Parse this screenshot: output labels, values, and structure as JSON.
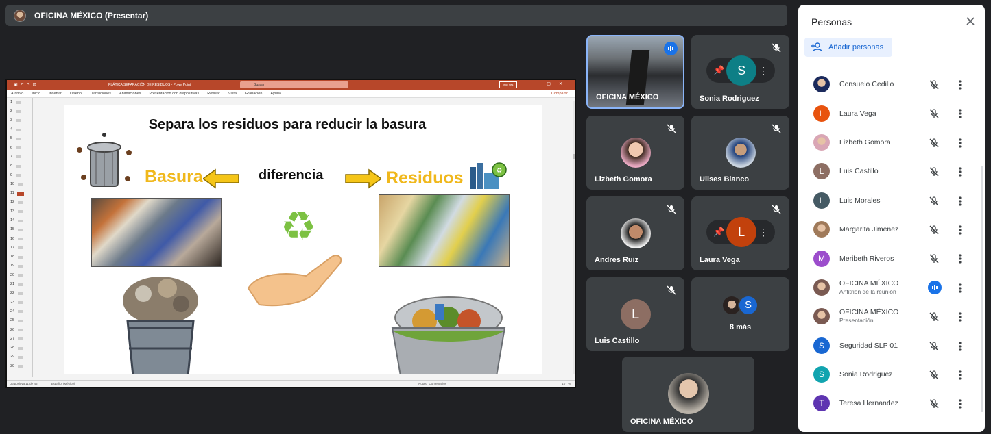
{
  "topbar": {
    "title": "OFICINA MÉXICO (Presentar)"
  },
  "ppt": {
    "window_title": "PLÁTICA SEPARACIÓN DE RESIDUOS - PowerPoint",
    "search_placeholder": "Buscar",
    "user_badge": "Inic. ses",
    "menu": [
      "Archivo",
      "Inicio",
      "Insertar",
      "Diseño",
      "Transiciones",
      "Animaciones",
      "Presentación con diapositivas",
      "Revisar",
      "Vista",
      "Grabación",
      "Ayuda"
    ],
    "share": "Compartir",
    "thumbnails": [
      "1",
      "2",
      "3",
      "4",
      "5",
      "6",
      "7",
      "8",
      "9",
      "10",
      "11",
      "12",
      "13",
      "14",
      "15",
      "16",
      "17",
      "18",
      "19",
      "20",
      "21",
      "22",
      "23",
      "24",
      "25",
      "26",
      "27",
      "28",
      "29",
      "30"
    ],
    "selected_slide": 11,
    "status_left": "Diapositiva 11 de 46",
    "status_lang": "Español (México)",
    "status_notes": "Notas",
    "status_comments": "Comentarios",
    "zoom": "107 %",
    "slide": {
      "heading": "Separa los residuos para reducir la basura",
      "left_word": "Basura",
      "middle_word": "diferencia",
      "right_word": "Residuos"
    }
  },
  "tiles": [
    {
      "name": "OFICINA MÉXICO",
      "speaking": true
    },
    {
      "name": "Sonia Rodriguez",
      "muted": true
    },
    {
      "name": "Lizbeth Gomora",
      "muted": true
    },
    {
      "name": "Ulises Blanco",
      "muted": true
    },
    {
      "name": "Andres Ruiz",
      "muted": true
    },
    {
      "name": "Laura Vega",
      "muted": true
    },
    {
      "name": "Luis Castillo",
      "muted": true,
      "initial": "L"
    },
    {
      "more_label": "8 más",
      "initial": "S"
    },
    {
      "name": "OFICINA MÉXICO"
    }
  ],
  "panel": {
    "title": "Personas",
    "add_label": "Añadir personas",
    "people": [
      {
        "name": "Consuelo Cedillo",
        "avatar": "photo",
        "color": "#1b2a5c"
      },
      {
        "name": "Laura Vega",
        "initial": "L",
        "color": "#e8530e"
      },
      {
        "name": "Lizbeth Gomora",
        "avatar": "photo",
        "color": "#d9a6b5"
      },
      {
        "name": "Luis Castillo",
        "initial": "L",
        "color": "#8d6e63"
      },
      {
        "name": "Luis Morales",
        "initial": "L",
        "color": "#455a64"
      },
      {
        "name": "Margarita Jimenez",
        "avatar": "photo",
        "color": "#a07a5a"
      },
      {
        "name": "Meribeth Riveros",
        "initial": "M",
        "color": "#9c4dcc"
      },
      {
        "name": "OFICINA MÉXICO",
        "sub": "Anfitrión de la reunión",
        "avatar": "photo",
        "color": "#7a5a52",
        "speaking": true
      },
      {
        "name": "OFICINA MÉXICO",
        "sub": "Presentación",
        "avatar": "photo",
        "color": "#7a5a52"
      },
      {
        "name": "Seguridad SLP 01",
        "initial": "S",
        "color": "#1967d2"
      },
      {
        "name": "Sonia Rodriguez",
        "initial": "S",
        "color": "#12a4af"
      },
      {
        "name": "Teresa Hernandez",
        "initial": "T",
        "color": "#5e35b1"
      }
    ]
  },
  "colors": {
    "accent": "#1a73e8",
    "ppt_brand": "#b7472a",
    "surface": "#3c4043",
    "background": "#202124"
  }
}
